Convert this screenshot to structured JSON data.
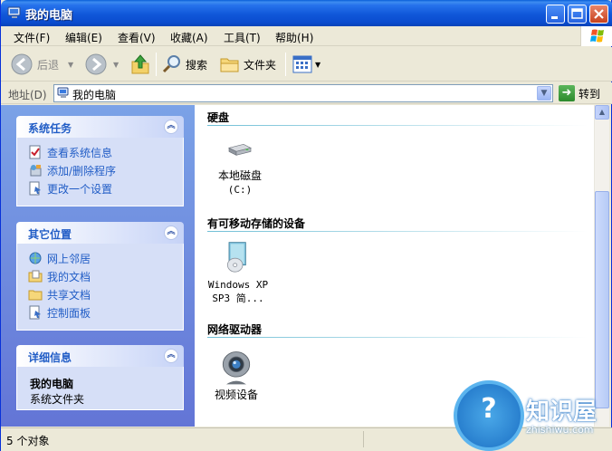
{
  "window": {
    "title": "我的电脑"
  },
  "menu": [
    "文件(F)",
    "编辑(E)",
    "查看(V)",
    "收藏(A)",
    "工具(T)",
    "帮助(H)"
  ],
  "toolbar": {
    "back_label": "后退",
    "search_label": "搜索",
    "folders_label": "文件夹"
  },
  "address": {
    "label": "地址(D)",
    "value": "我的电脑",
    "go_label": "转到"
  },
  "left_pane": {
    "system_tasks": {
      "title": "系统任务",
      "items": [
        {
          "label": "查看系统信息",
          "icon": "system-info-icon"
        },
        {
          "label": "添加/删除程序",
          "icon": "add-remove-programs-icon"
        },
        {
          "label": "更改一个设置",
          "icon": "control-panel-icon"
        }
      ]
    },
    "other_places": {
      "title": "其它位置",
      "items": [
        {
          "label": "网上邻居",
          "icon": "network-places-icon"
        },
        {
          "label": "我的文档",
          "icon": "my-documents-icon"
        },
        {
          "label": "共享文档",
          "icon": "shared-documents-icon"
        },
        {
          "label": "控制面板",
          "icon": "control-panel-icon"
        }
      ]
    },
    "details": {
      "title": "详细信息",
      "name": "我的电脑",
      "type": "系统文件夹"
    }
  },
  "content": {
    "groups": [
      {
        "title": "硬盘",
        "items": [
          {
            "label_line1": "本地磁盘",
            "label_line2": "(C:)",
            "icon": "hard-disk-icon"
          }
        ]
      },
      {
        "title": "有可移动存储的设备",
        "items": [
          {
            "label_line1": "Windows XP",
            "label_line2": "SP3 简...",
            "icon": "cd-drive-icon"
          }
        ]
      },
      {
        "title": "网络驱动器",
        "items": [
          {
            "label_line1": "视频设备",
            "label_line2": "",
            "icon": "webcam-icon"
          }
        ]
      }
    ]
  },
  "status": {
    "text": "5 个对象"
  },
  "watermark": {
    "text": "知识屋",
    "sub": "zhishiwu.com"
  },
  "colors": {
    "title_bar": "#2672ec",
    "task_pane": "#6f8fe0",
    "link": "#215dc6"
  }
}
